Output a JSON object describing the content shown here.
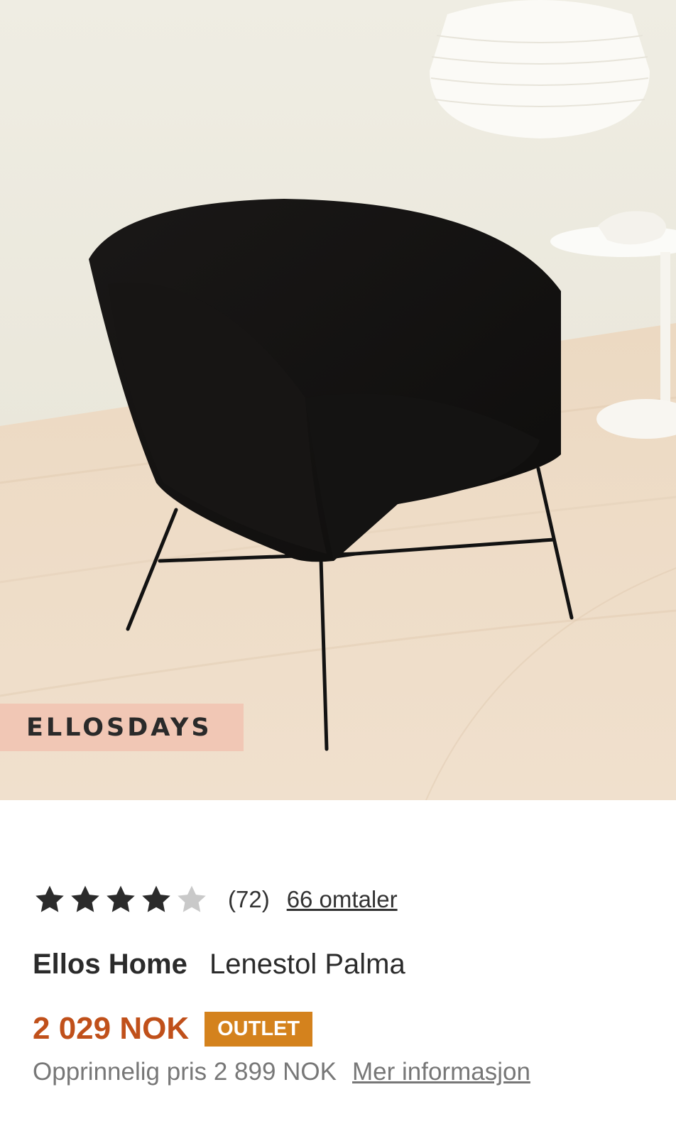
{
  "hero": {
    "badge_label": "ELLOSDAYS"
  },
  "rating": {
    "stars": 4,
    "max_stars": 5,
    "count_label": "(72)",
    "reviews_link": "66 omtaler"
  },
  "product": {
    "brand": "Ellos Home",
    "name": "Lenestol Palma"
  },
  "price": {
    "current": "2 029 NOK",
    "tag": "OUTLET",
    "original": "Opprinnelig pris 2 899 NOK",
    "more_info": "Mer informasjon"
  },
  "colors": {
    "price": "#c0501a",
    "outlet_bg": "#d4821d",
    "badge_bg": "#f1c7b5",
    "star_filled": "#2b2b2b",
    "star_empty": "#c9c9c9"
  }
}
